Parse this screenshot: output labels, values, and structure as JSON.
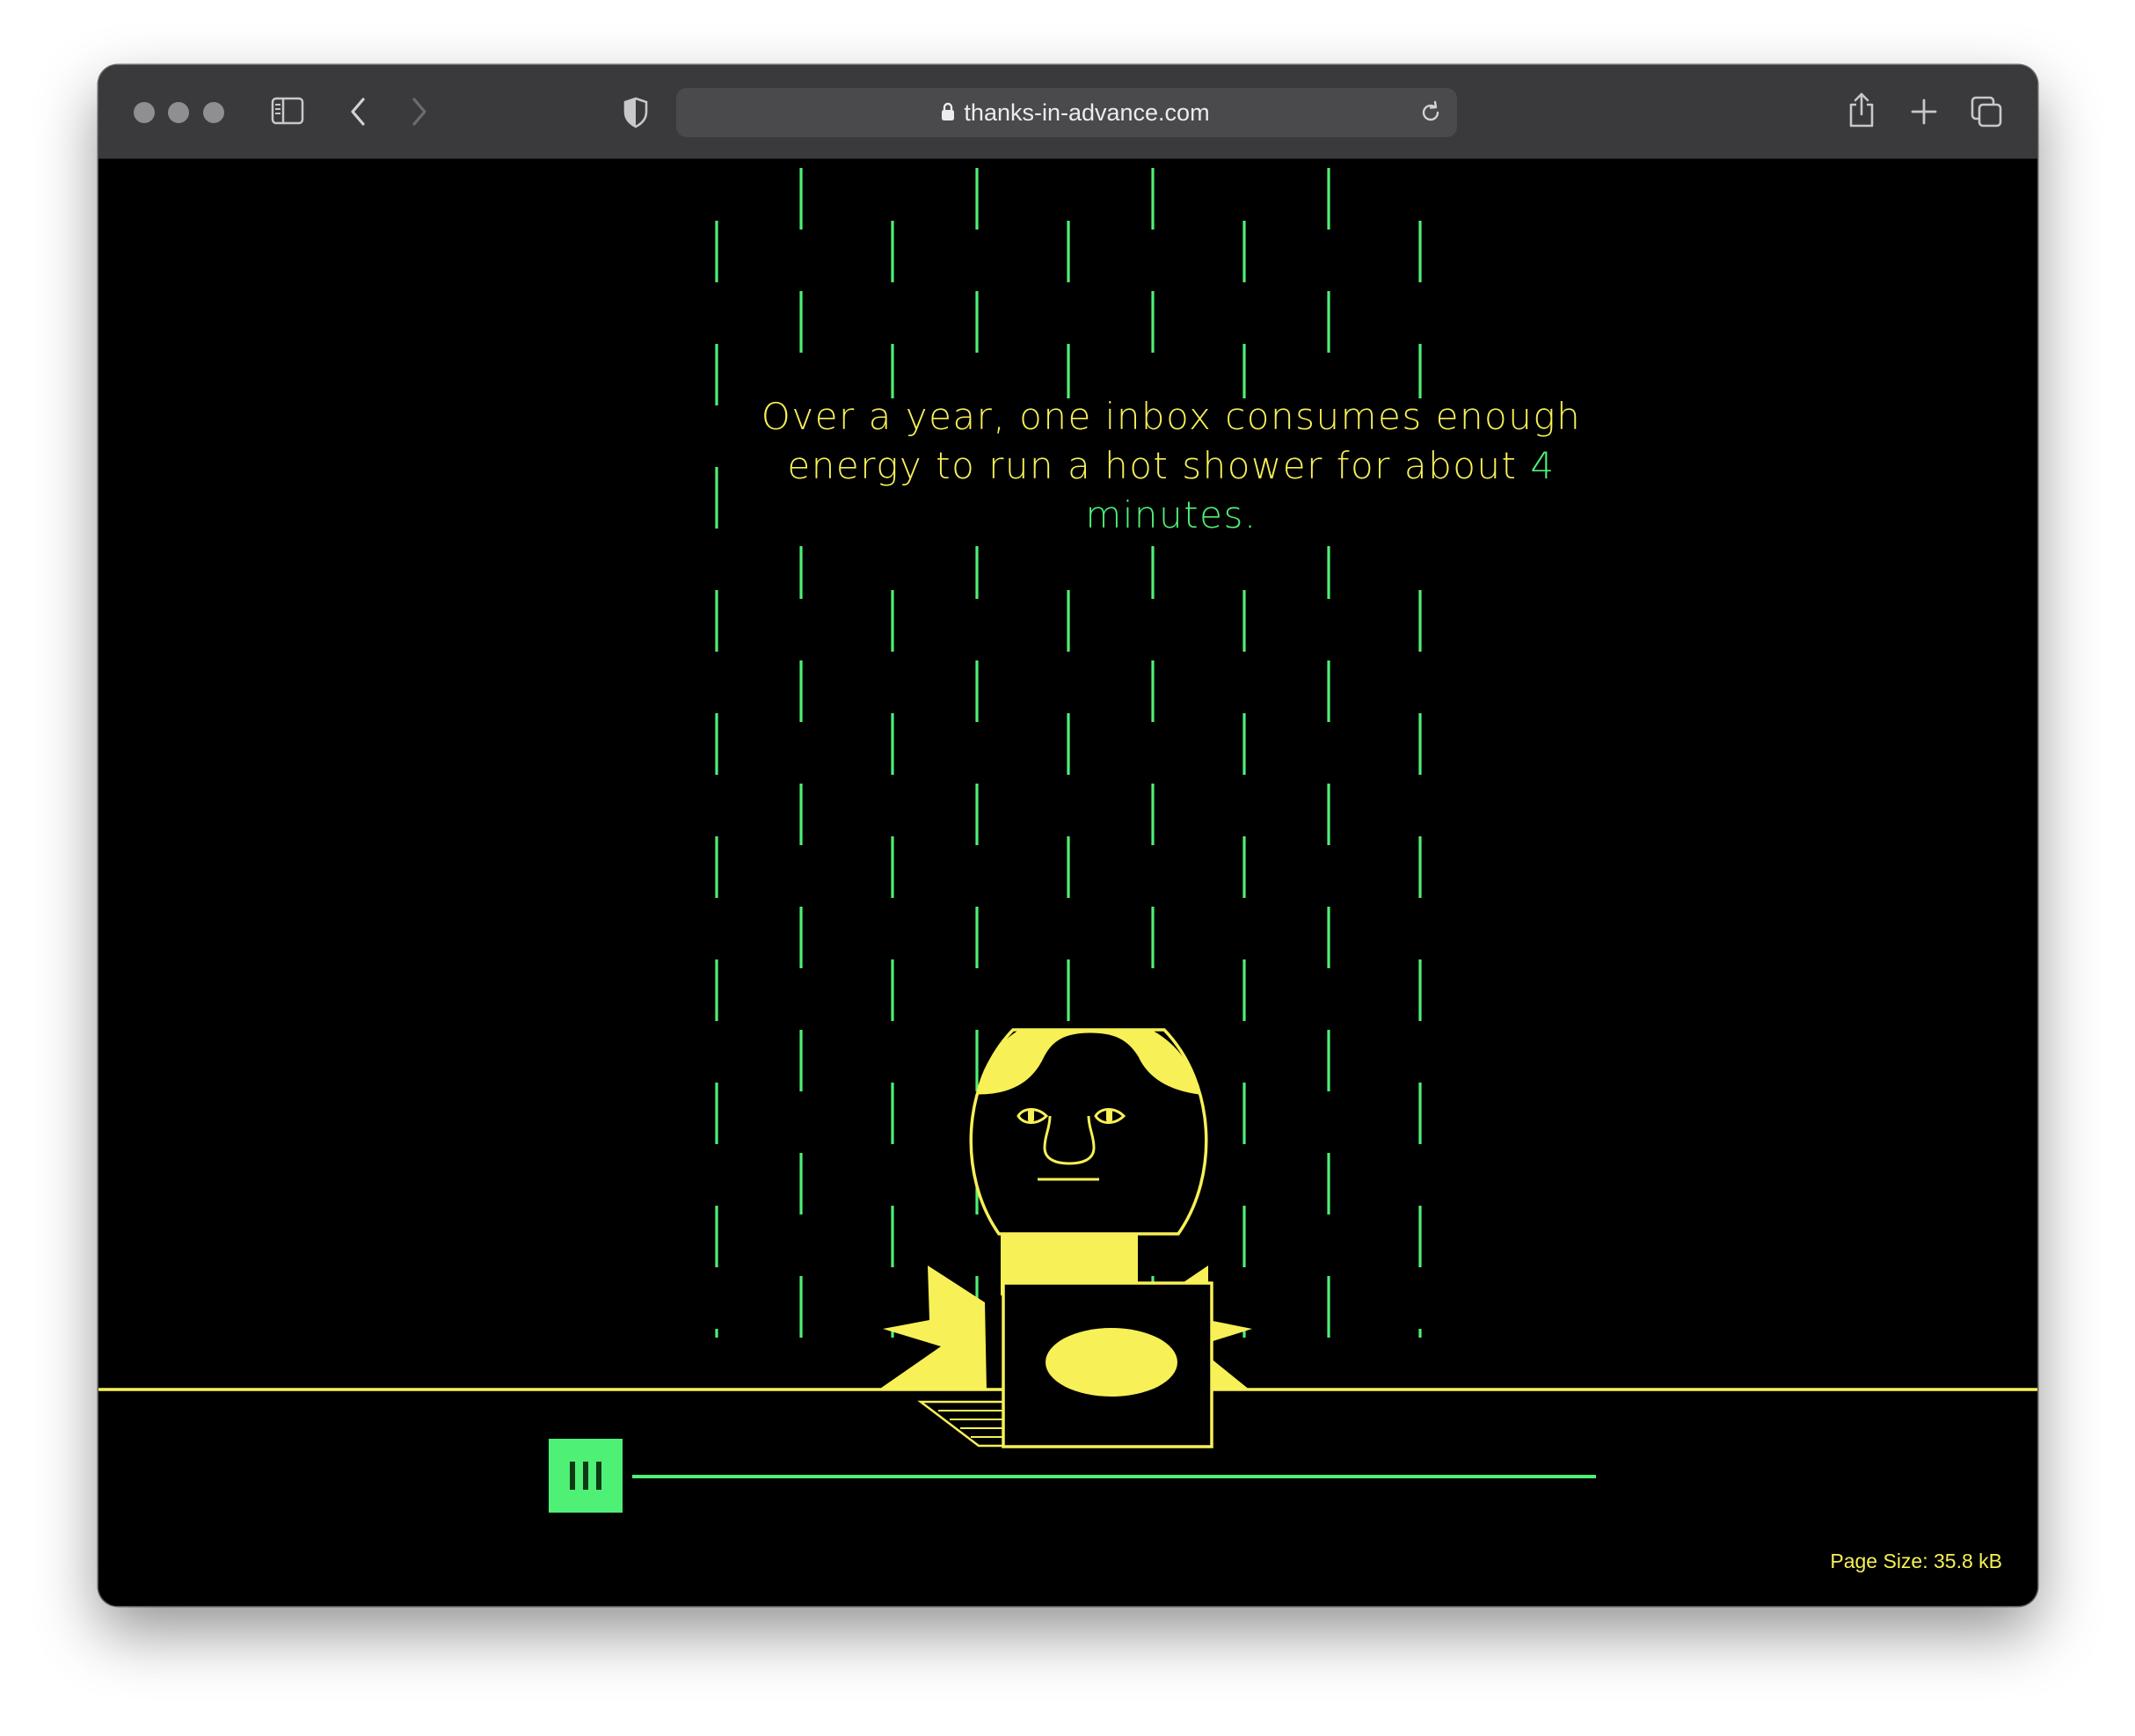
{
  "browser": {
    "url": "thanks-in-advance.com",
    "icons": [
      "traffic-light-icons",
      "sidebar-icon",
      "back-icon",
      "forward-icon",
      "shield-icon",
      "lock-icon",
      "reload-icon",
      "share-icon",
      "new-tab-icon",
      "tab-overview-icon"
    ]
  },
  "page": {
    "headline_part1": "Over a year, one inbox consumes enough energy to run a hot shower for about ",
    "headline_highlight": "4 minutes.",
    "page_size": "Page Size: 35.8 kB",
    "play_button_icon": "pause-bars-icon"
  },
  "colors": {
    "background": "#000000",
    "yellow": "#f7f057",
    "green": "#4ef075",
    "toolbar": "#3a3a3c"
  }
}
